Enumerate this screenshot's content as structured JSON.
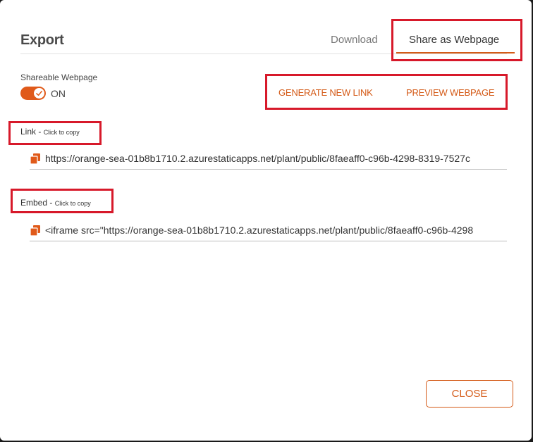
{
  "dialog": {
    "title": "Export",
    "tabs": [
      {
        "label": "Download",
        "active": false
      },
      {
        "label": "Share as Webpage",
        "active": true
      }
    ]
  },
  "shareable": {
    "label": "Shareable Webpage",
    "state": "ON",
    "enabled": true
  },
  "actions": {
    "generate_label": "GENERATE NEW LINK",
    "preview_label": "PREVIEW WEBPAGE"
  },
  "link": {
    "label": "Link -",
    "hint": "Click to copy",
    "value": "https://orange-sea-01b8b1710.2.azurestaticapps.net/plant/public/8faeaff0-c96b-4298-8319-7527c",
    "icon": "copy-icon"
  },
  "embed": {
    "label": "Embed -",
    "hint": "Click to copy",
    "value": "<iframe src=\"https://orange-sea-01b8b1710.2.azurestaticapps.net/plant/public/8faeaff0-c96b-4298",
    "icon": "copy-icon"
  },
  "footer": {
    "close_label": "CLOSE"
  },
  "colors": {
    "accent": "#d45a17",
    "toggle_on": "#e05a1a",
    "highlight": "#d7192a"
  }
}
